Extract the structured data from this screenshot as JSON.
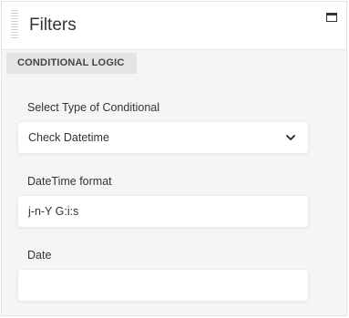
{
  "panel": {
    "title": "Filters",
    "section_tab": "CONDITIONAL LOGIC"
  },
  "fields": {
    "conditional_type": {
      "label": "Select Type of Conditional",
      "value": "Check Datetime"
    },
    "datetime_format": {
      "label": "DateTime format",
      "value": "j-n-Y G:i:s"
    },
    "date": {
      "label": "Date",
      "value": ""
    }
  },
  "icons": {
    "drag": "drag-handle-icon",
    "window": "window-maximize-icon",
    "dropdown": "chevron-down-icon"
  }
}
